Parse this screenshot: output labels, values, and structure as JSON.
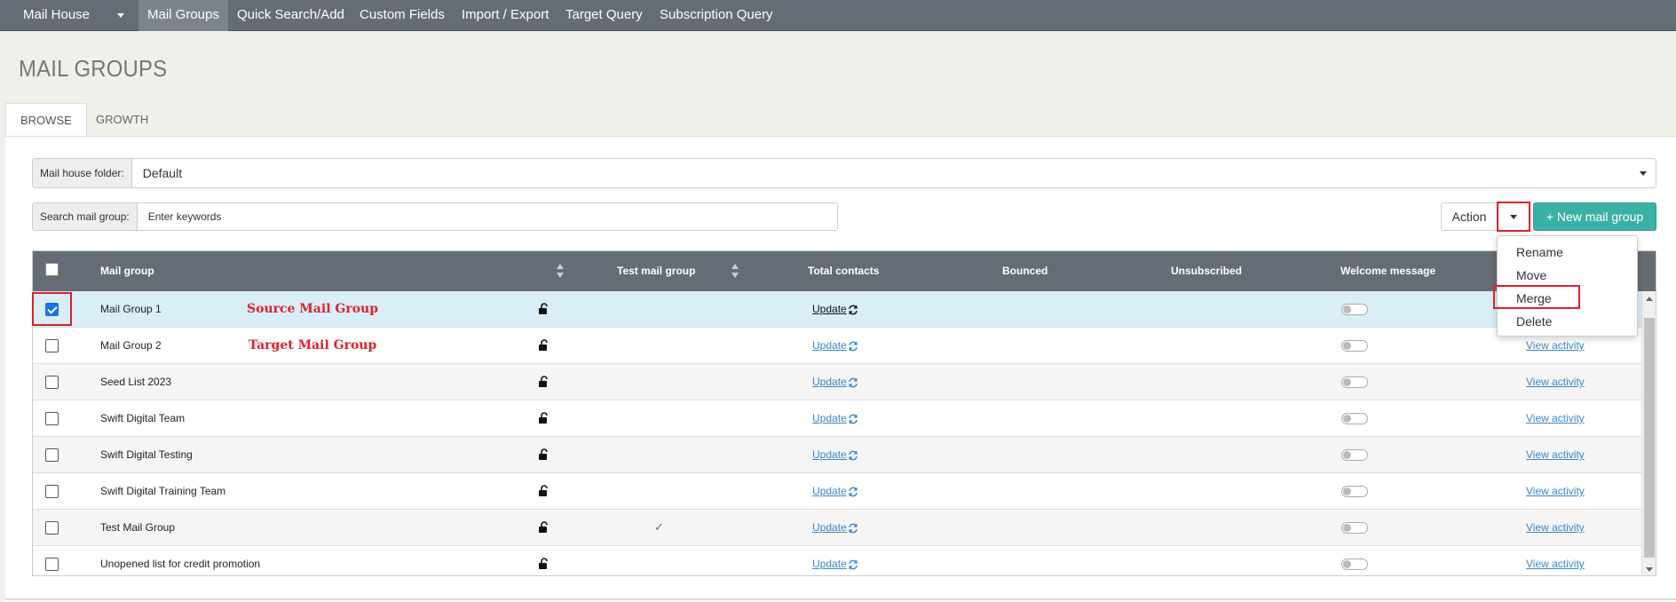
{
  "nav": {
    "items": [
      "Mail House",
      "Mail Groups",
      "Quick Search/Add",
      "Custom Fields",
      "Import / Export",
      "Target Query",
      "Subscription Query"
    ]
  },
  "page": {
    "title": "MAIL GROUPS"
  },
  "tabs": [
    "BROWSE",
    "GROWTH"
  ],
  "folder": {
    "label": "Mail house folder:",
    "value": "Default"
  },
  "search": {
    "label": "Search mail group:",
    "placeholder": "Enter keywords"
  },
  "toolbar": {
    "action_label": "Action",
    "new_label": "+ New mail group"
  },
  "action_menu": [
    "Rename",
    "Move",
    "Merge",
    "Delete"
  ],
  "table": {
    "columns": [
      "Mail group",
      "Test mail group",
      "Total contacts",
      "Bounced",
      "Unsubscribed",
      "Welcome message"
    ],
    "rows": [
      {
        "name": "Mail Group 1",
        "checked": true,
        "test": false,
        "update": "Update",
        "activity": ""
      },
      {
        "name": "Mail Group 2",
        "checked": false,
        "test": false,
        "update": "Update",
        "activity": "View activity"
      },
      {
        "name": "Seed List 2023",
        "checked": false,
        "test": false,
        "update": "Update",
        "activity": "View activity"
      },
      {
        "name": "Swift Digital Team",
        "checked": false,
        "test": false,
        "update": "Update",
        "activity": "View activity"
      },
      {
        "name": "Swift Digital Testing",
        "checked": false,
        "test": false,
        "update": "Update",
        "activity": "View activity"
      },
      {
        "name": "Swift Digital Training Team",
        "checked": false,
        "test": false,
        "update": "Update",
        "activity": "View activity"
      },
      {
        "name": "Test Mail Group",
        "checked": false,
        "test": true,
        "update": "Update",
        "activity": "View activity"
      },
      {
        "name": "Unopened list for credit promotion",
        "checked": false,
        "test": false,
        "update": "Update",
        "activity": "View activity"
      }
    ]
  },
  "annotations": {
    "source": "Source Mail Group",
    "target": "Target Mail Group"
  },
  "colors": {
    "nav_bg": "#656c75",
    "accent": "#3bb0a6",
    "highlight": "#e0202a",
    "link": "#3a87c8"
  }
}
